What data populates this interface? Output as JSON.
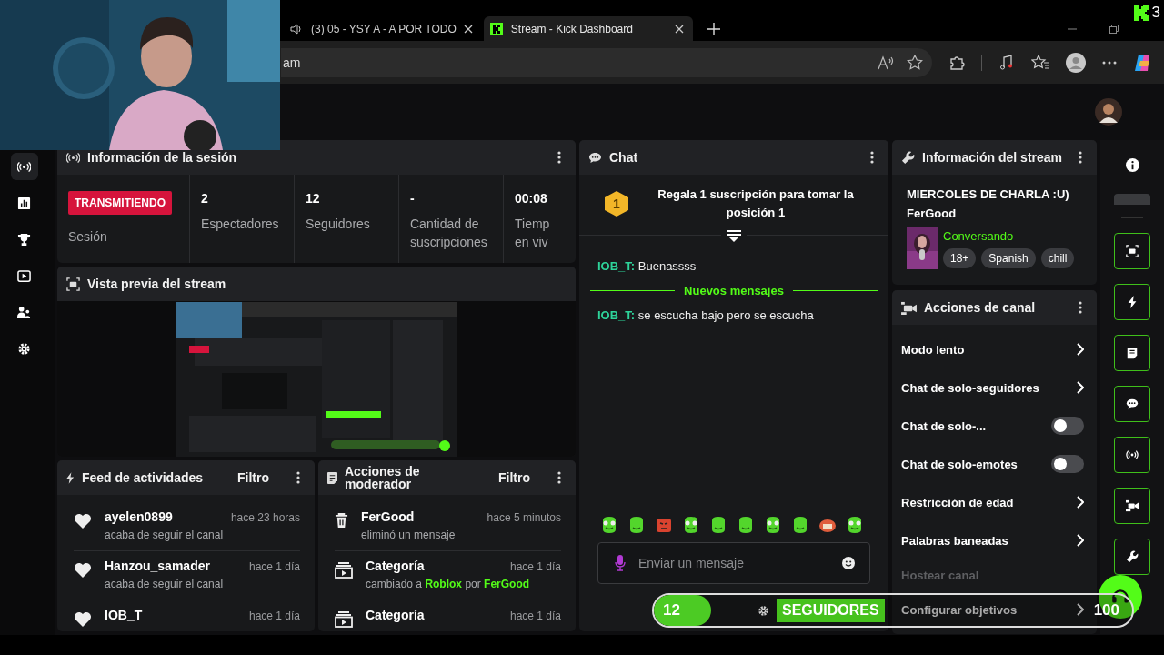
{
  "browser": {
    "tabs": [
      {
        "title": "(3) 05 - YSY A - A POR TODO",
        "selected": false,
        "audio": true
      },
      {
        "title": "Stream - Kick Dashboard",
        "selected": true,
        "audio": false
      }
    ],
    "address": "am"
  },
  "notification_badge": {
    "count": "3"
  },
  "session": {
    "title": "Información de la sesión",
    "status": "TRANSMITIENDO",
    "status_label": "Sesión",
    "stats": [
      {
        "value": "2",
        "label": "Espectadores"
      },
      {
        "value": "12",
        "label": "Seguidores"
      },
      {
        "value": "-",
        "label": "Cantidad de suscripciones"
      },
      {
        "value": "00:08",
        "label": "Tiemp en viv"
      }
    ]
  },
  "preview": {
    "title": "Vista previa del stream"
  },
  "activity": {
    "title": "Feed de actividades",
    "filter": "Filtro",
    "items": [
      {
        "user": "ayelen0899",
        "time": "hace 23 horas",
        "text": "acaba de seguir el canal"
      },
      {
        "user": "Hanzou_samader",
        "time": "hace 1 día",
        "text": "acaba de seguir el canal"
      },
      {
        "user": "IOB_T",
        "time": "hace 1 día"
      }
    ]
  },
  "moderator": {
    "title": "Acciones de moderador",
    "filter": "Filtro",
    "items": [
      {
        "kind": "delete",
        "user": "FerGood",
        "time": "hace 5 minutos",
        "text": "eliminó un mensaje"
      },
      {
        "kind": "category",
        "user": "Categoría",
        "time": "hace 1 día",
        "text": "cambiado a **Roblox** por **FerGood**"
      },
      {
        "kind": "category",
        "user": "Categoría",
        "time": "hace 1 día"
      }
    ]
  },
  "chat": {
    "title": "Chat",
    "pinned": {
      "rank": "1",
      "text": "Regala 1 suscripción para tomar la posición 1"
    },
    "messages": [
      {
        "kind": "message",
        "user": "IOB_T:",
        "text": "Buenassss"
      },
      {
        "kind": "divider",
        "text": "Nuevos mensajes"
      },
      {
        "kind": "message",
        "user": "IOB_T:",
        "text": "se escucha bajo pero se escucha"
      }
    ],
    "input": {
      "placeholder": "Enviar un mensaje"
    }
  },
  "stream_info": {
    "title": "Información del stream",
    "stream_title": "MIERCOLES DE CHARLA :U)",
    "streamer": "FerGood",
    "category": "Conversando",
    "tags": [
      "18+",
      "Spanish",
      "chill"
    ]
  },
  "channel_actions": {
    "title": "Acciones de canal",
    "items": [
      {
        "kind": "link",
        "label": "Modo lento"
      },
      {
        "kind": "link",
        "label": "Chat de solo-seguidores"
      },
      {
        "kind": "toggle",
        "label": "Chat de solo-...",
        "on": false
      },
      {
        "kind": "toggle",
        "label": "Chat de solo-emotes",
        "on": false
      },
      {
        "kind": "link",
        "label": "Restricción de edad"
      },
      {
        "kind": "link",
        "label": "Palabras baneadas"
      },
      {
        "kind": "disabled",
        "label": "Hostear canal"
      },
      {
        "kind": "link",
        "label": "Configurar objetivos"
      }
    ]
  },
  "follower_goal": {
    "current": "12",
    "label": "SEGUIDORES",
    "target": "100",
    "level": 0.12
  }
}
